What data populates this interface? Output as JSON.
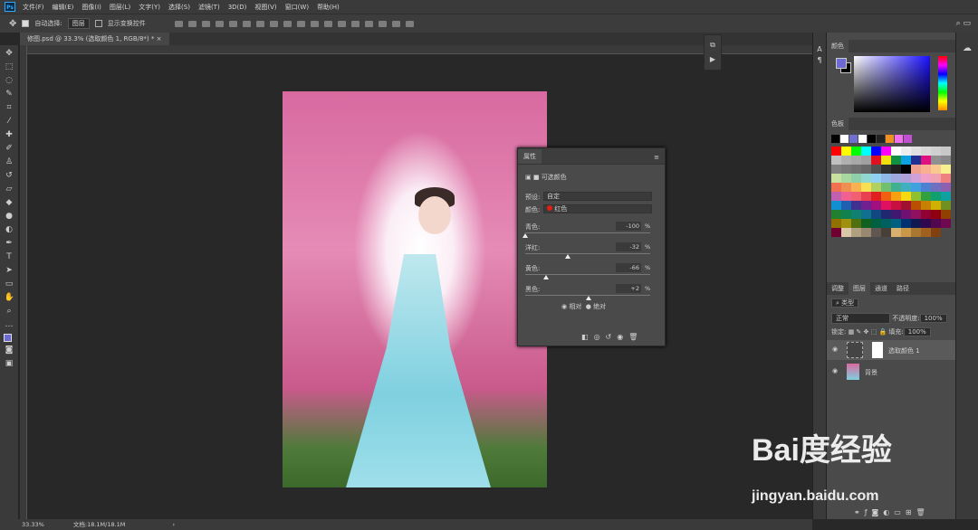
{
  "menu": [
    "文件(F)",
    "编辑(E)",
    "图像(I)",
    "图层(L)",
    "文字(Y)",
    "选择(S)",
    "滤镜(T)",
    "3D(D)",
    "视图(V)",
    "窗口(W)",
    "帮助(H)"
  ],
  "options": {
    "auto_select": "自动选择:",
    "auto_select_target": "图层",
    "show_transform": "显示变换控件"
  },
  "document_tab": "修图.psd @ 33.3% (选取颜色 1, RGB/8*) *",
  "properties": {
    "title": "属性",
    "adjustment": "可选颜色",
    "preset_label": "预设:",
    "preset_value": "自定",
    "colors_label": "颜色:",
    "colors_value": "红色",
    "sliders": [
      {
        "label": "青色:",
        "value": "-100",
        "fraction": 0.0
      },
      {
        "label": "洋红:",
        "value": "-32",
        "fraction": 0.34
      },
      {
        "label": "黄色:",
        "value": "-66",
        "fraction": 0.17
      },
      {
        "label": "黑色:",
        "value": "+2",
        "fraction": 0.51
      }
    ],
    "pct": "%",
    "method_relative": "相对",
    "method_absolute": "绝对"
  },
  "color_panel": {
    "title": "颜色",
    "foreground": "#6e6ad4",
    "background": "#000000"
  },
  "swatches_panel": {
    "title": "色板",
    "recent": [
      "#000000",
      "#ffffff",
      "#7070d0",
      "#ffffff",
      "#000000",
      "#222222",
      "#f09020",
      "#f070f0",
      "#c050d0"
    ],
    "colors": [
      "#ff0000",
      "#ffff00",
      "#00ff00",
      "#00ffff",
      "#0000ff",
      "#ff00ff",
      "#ffffff",
      "#eeeeee",
      "#e0e0e0",
      "#d8d8d8",
      "#d0d0d0",
      "#c8c8c8",
      "#c0c0c0",
      "#b0b0b0",
      "#a8a8a8",
      "#a0a0a0",
      "#e01020",
      "#f0e010",
      "#109040",
      "#10a0e0",
      "#203090",
      "#e01080",
      "#909090",
      "#888888",
      "#808080",
      "#787878",
      "#707070",
      "#686868",
      "#505050",
      "#303030",
      "#202020",
      "#000000",
      "#f0a090",
      "#f8b090",
      "#f8c890",
      "#f8f090",
      "#c8e0a0",
      "#a8d8a0",
      "#90d0a8",
      "#90d8d0",
      "#90d0f0",
      "#90b8e8",
      "#a0a8e0",
      "#b0a0d8",
      "#d0a0d8",
      "#f0a0c8",
      "#f0a0b0",
      "#f08080",
      "#f07050",
      "#f09050",
      "#f8b050",
      "#f8e050",
      "#b0d060",
      "#70c070",
      "#40b090",
      "#40b0c0",
      "#40a0e0",
      "#5080d0",
      "#7070c0",
      "#9060b0",
      "#c060b0",
      "#f06090",
      "#f06070",
      "#e84050",
      "#e02020",
      "#f06010",
      "#f8a010",
      "#f8d810",
      "#90c030",
      "#30a040",
      "#10a070",
      "#10a0a0",
      "#1090d0",
      "#2060b0",
      "#403090",
      "#702090",
      "#a01080",
      "#e01060",
      "#c81040",
      "#a01030",
      "#b85000",
      "#c88000",
      "#d0b000",
      "#709020",
      "#208030",
      "#108050",
      "#108070",
      "#107090",
      "#104880",
      "#202870",
      "#401870",
      "#701070",
      "#901060",
      "#900030",
      "#900010",
      "#904000",
      "#907000",
      "#a09010",
      "#507010",
      "#106020",
      "#006040",
      "#006060",
      "#006080",
      "#003070",
      "#101850",
      "#300850",
      "#500850",
      "#700850",
      "#700030",
      "#d8c8a8",
      "#b0a080",
      "#988870",
      "#605850",
      "#484038",
      "#d8b070",
      "#c89848",
      "#a87830",
      "#a06020",
      "#804010"
    ]
  },
  "layers_panel": {
    "tabs": [
      "调整",
      "图层",
      "通道",
      "路径"
    ],
    "filter": "类型",
    "blend": "正常",
    "opacity_label": "不透明度:",
    "opacity": "100%",
    "lock_label": "锁定:",
    "fill_label": "填充:",
    "fill": "100%",
    "layers": [
      {
        "name": "选取颜色 1"
      },
      {
        "name": "背景"
      }
    ]
  },
  "status": {
    "zoom": "33.33%",
    "doc": "文档:18.1M/18.1M"
  },
  "watermark": {
    "brand": "Bai度经验",
    "url": "jingyan.baidu.com"
  }
}
